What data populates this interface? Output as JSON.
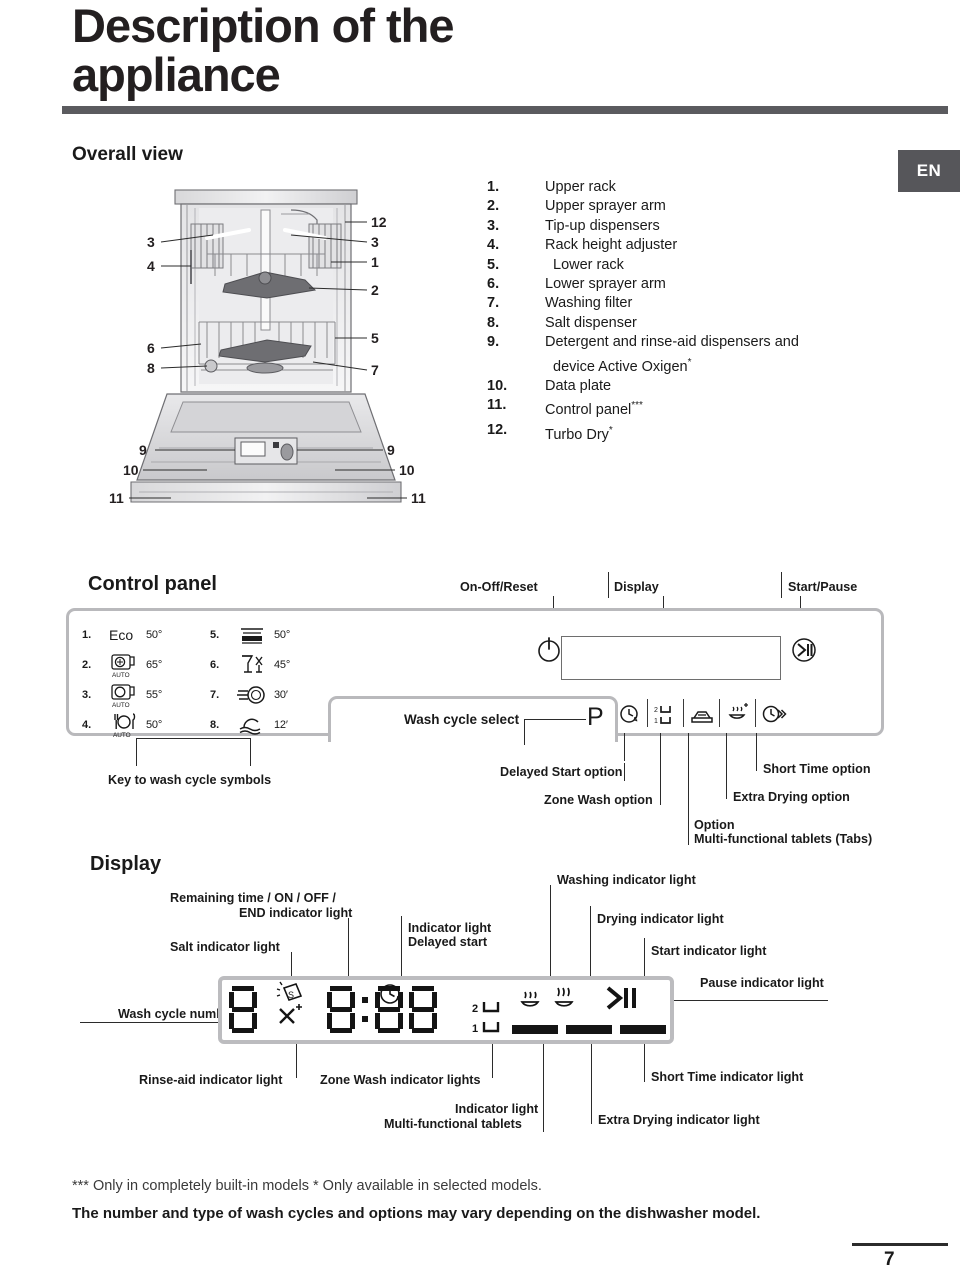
{
  "document": {
    "title": "Description of the\nappliance",
    "title_line1": "Description of the",
    "title_line2": "appliance",
    "language_badge": "EN",
    "page_number": "7"
  },
  "overall_view": {
    "heading": "Overall view",
    "parts": [
      {
        "num": "1.",
        "label": "Upper rack"
      },
      {
        "num": "2.",
        "label": "Upper sprayer arm"
      },
      {
        "num": "3.",
        "label": "Tip-up dispensers"
      },
      {
        "num": "4.",
        "label": "Rack height adjuster"
      },
      {
        "num": "5.",
        "label": "Lower rack"
      },
      {
        "num": "6.",
        "label": "Lower sprayer arm"
      },
      {
        "num": "7.",
        "label": "Washing filter"
      },
      {
        "num": "8.",
        "label": "Salt dispenser"
      },
      {
        "num": "9.",
        "label": "Detergent and rinse-aid dispensers and"
      },
      {
        "num": "",
        "label": "device Active Oxigen",
        "sup": "*"
      },
      {
        "num": "10.",
        "label": "Data plate"
      },
      {
        "num": "11.",
        "label": "Control panel",
        "sup": "***"
      },
      {
        "num": "12.",
        "label": "Turbo Dry",
        "sup": "*"
      }
    ],
    "diagram_callouts": [
      "12",
      "3",
      "1",
      "2",
      "5",
      "7",
      "3",
      "4",
      "6",
      "8",
      "9",
      "9",
      "10",
      "10",
      "11",
      "11"
    ]
  },
  "control_panel": {
    "heading": "Control panel",
    "top_labels": {
      "on_off_reset": "On-Off/Reset",
      "display": "Display",
      "start_pause": "Start/Pause"
    },
    "wash_cycle_select_label": "Wash cycle select",
    "program_letter": "P",
    "key_label": "Key to wash cycle symbols",
    "wash_cycles": [
      {
        "num": "1.",
        "icon": "eco-text-icon",
        "name": "Eco",
        "temp": "50°"
      },
      {
        "num": "2.",
        "icon": "auto-pots-icon",
        "name": "AUTO",
        "temp": "65°"
      },
      {
        "num": "3.",
        "icon": "auto-pan-icon",
        "name": "AUTO",
        "temp": "55°"
      },
      {
        "num": "4.",
        "icon": "auto-cutlery-icon",
        "name": "AUTO",
        "temp": "50°"
      },
      {
        "num": "5.",
        "icon": "half-load-rack-icon",
        "name": "",
        "temp": "50°"
      },
      {
        "num": "6.",
        "icon": "delicate-glass-icon",
        "name": "",
        "temp": "45°"
      },
      {
        "num": "7.",
        "icon": "fast-plate-icon",
        "name": "",
        "temp": "30′"
      },
      {
        "num": "8.",
        "icon": "rapid-wave-icon",
        "name": "",
        "temp": "12′"
      }
    ],
    "option_buttons": [
      {
        "icon": "delayed-start-icon",
        "label": "Delayed Start option"
      },
      {
        "icon": "zone-wash-icon",
        "label": "Zone Wash option"
      },
      {
        "icon": "tablets-tray-icon",
        "label": "Option\nMulti-functional tablets (Tabs)",
        "label_line1": "Option",
        "label_line2": "Multi-functional tablets (Tabs)"
      },
      {
        "icon": "extra-drying-icon",
        "label": "Extra Drying option"
      },
      {
        "icon": "short-time-icon",
        "label": "Short Time option"
      }
    ]
  },
  "display_section": {
    "heading": "Display",
    "labels": {
      "wash_cycle_number": "Wash cycle number",
      "remaining_time_line1": "Remaining time / ON / OFF /",
      "remaining_time_line2": "END indicator light",
      "salt": "Salt indicator light",
      "rinse_aid": "Rinse-aid indicator light",
      "delayed_start_line1": "Indicator light",
      "delayed_start_line2": "Delayed start",
      "zone_wash": "Zone Wash indicator lights",
      "tablets_line1": "Indicator light",
      "tablets_line2": "Multi-functional tablets",
      "washing": "Washing indicator light",
      "drying": "Drying indicator light",
      "start": "Start indicator light",
      "pause": "Pause indicator light",
      "extra_drying": "Extra Drying indicator light",
      "short_time": "Short Time indicator light"
    },
    "readout": {
      "cycle_digit": "8",
      "time_digits": "8:88",
      "zone_top": "2",
      "zone_bottom": "1",
      "salt_icon": "salt-s-icon",
      "rinse_aid_icon": "rinse-aid-star-icon",
      "delayed_start_icon": "delayed-start-clock-icon",
      "washing_icon": "washing-drop-icon",
      "drying_icon": "drying-steam-icon",
      "start_pause_icon": "play-pause-icon"
    }
  },
  "footnotes": {
    "note1_a": "***",
    "note1_b": "Only in completely built-in models",
    "note1_c": "*",
    "note1_d": "Only available in selected models.",
    "note2": "The number and type of wash cycles and options may vary depending on the dishwasher model."
  },
  "colors": {
    "rule": "#5b5b5f",
    "badge_bg": "#56565a",
    "panel_border": "#b9b9bc",
    "ink": "#231f20"
  }
}
